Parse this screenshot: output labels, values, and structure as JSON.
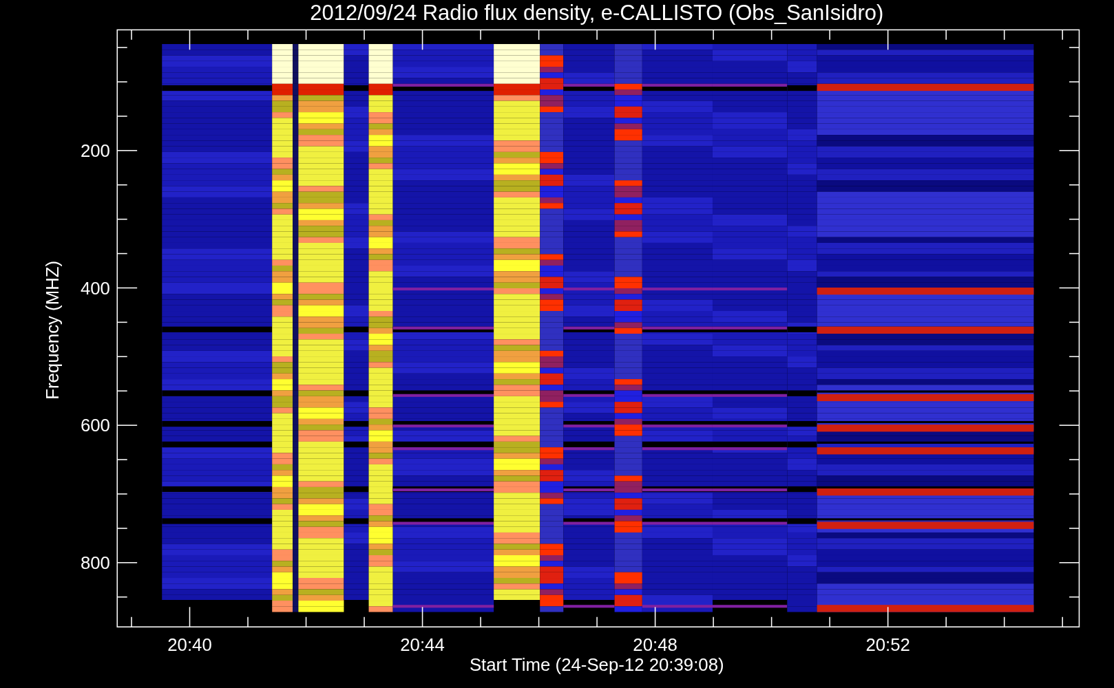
{
  "plot": {
    "title": "2012/09/24  Radio flux density, e-CALLISTO (Obs_SanIsidro)",
    "ylabel": "Frequency (MHZ)",
    "xlabel": "Start Time (24-Sep-12 20:39:08)",
    "ytick_labels": [
      "200",
      "400",
      "600",
      "800"
    ],
    "xtick_labels": [
      "20:40",
      "20:44",
      "20:48",
      "20:52"
    ]
  }
}
